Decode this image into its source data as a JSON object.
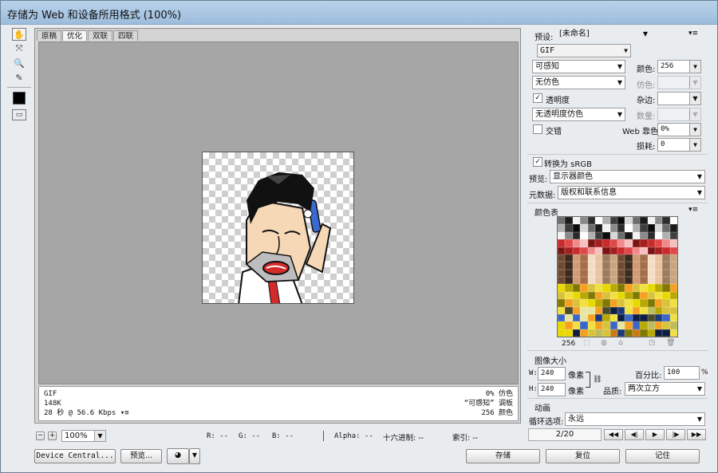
{
  "window": {
    "title": "存储为 Web 和设备所用格式 (100%)"
  },
  "tools": [
    "hand-icon",
    "slice-select-icon",
    "zoom-icon",
    "eyedropper-icon",
    "color-swatch-icon",
    "toggle-slices-icon"
  ],
  "tabs": [
    "原稿",
    "优化",
    "双联",
    "四联"
  ],
  "info_left": [
    "GIF",
    "148K",
    "28 秒 @ 56.6 Kbps"
  ],
  "info_right": [
    "0% 仿色",
    "“可感知” 调板",
    "256 颜色"
  ],
  "status": {
    "zoom": "100%",
    "r": "R: --",
    "g": "G: --",
    "b": "B: --",
    "alpha": "Alpha: --",
    "hex": "十六进制: --",
    "index": "索引: --"
  },
  "bottom_buttons": {
    "device_central": "Device Central...",
    "preview": "预览...",
    "save": "存储",
    "reset": "复位",
    "remember": "记住"
  },
  "settings": {
    "preset_label": "预设:",
    "preset_value": "[未命名]",
    "format": "GIF",
    "reduction": "可感知",
    "dither_algo": "无仿色",
    "transparency_label": "透明度",
    "transparency_checked": true,
    "matte_dither": "无透明度仿色",
    "interlaced_label": "交错",
    "interlaced_checked": false,
    "colors_label": "颜色:",
    "colors_value": "256",
    "dither_label": "仿色:",
    "matte_label": "杂边:",
    "amount_label": "数量:",
    "websnap_label": "Web 靠色:",
    "websnap_value": "0%",
    "lossy_label": "损耗:",
    "lossy_value": "0",
    "srgb_label": "转换为 sRGB",
    "srgb_checked": true,
    "preview_label": "预览:",
    "preview_value": "显示器颜色",
    "metadata_label": "元数据:",
    "metadata_value": "版权和联系信息"
  },
  "color_table": {
    "title": "颜色表",
    "count": "256"
  },
  "image_size": {
    "title": "图像大小",
    "w_label": "W:",
    "w_value": "240",
    "h_label": "H:",
    "h_value": "240",
    "unit": "像素",
    "percent_label": "百分比:",
    "percent_value": "100",
    "percent_unit": "%",
    "quality_label": "品质:",
    "quality_value": "两次立方"
  },
  "animation": {
    "title": "动画",
    "loop_label": "循环选项:",
    "loop_value": "永远",
    "frame": "2/20"
  }
}
